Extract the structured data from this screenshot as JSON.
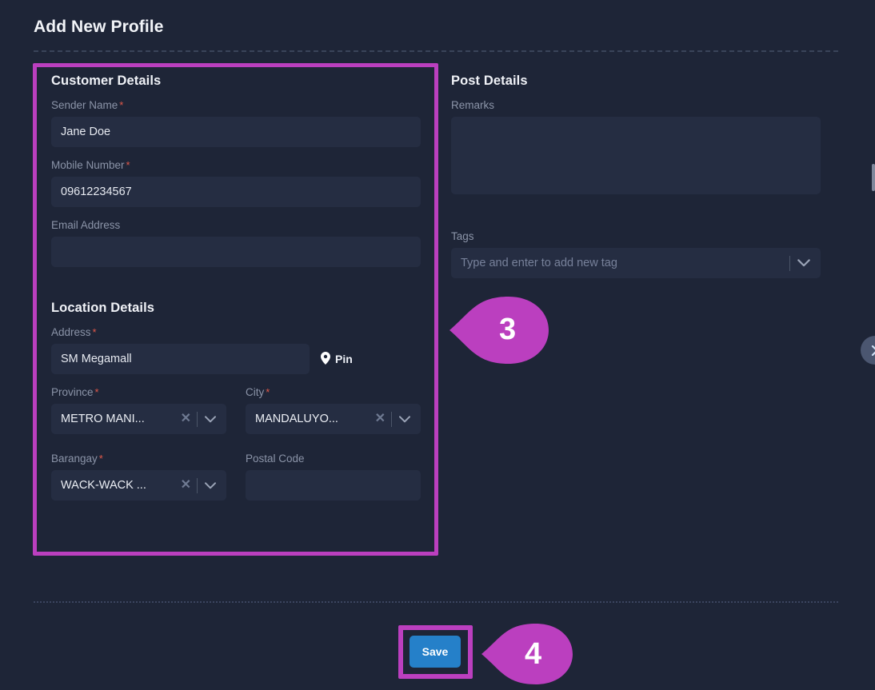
{
  "header": {
    "title": "Add New Profile"
  },
  "customer": {
    "section_title": "Customer Details",
    "sender_name": {
      "label": "Sender Name",
      "required": "*",
      "value": "Jane Doe"
    },
    "mobile_number": {
      "label": "Mobile Number",
      "required": "*",
      "value": "09612234567"
    },
    "email_address": {
      "label": "Email Address",
      "value": ""
    }
  },
  "location": {
    "section_title": "Location Details",
    "address": {
      "label": "Address",
      "required": "*",
      "value": "SM Megamall"
    },
    "pin_button": {
      "label": "Pin",
      "icon": "map-pin-icon"
    },
    "province": {
      "label": "Province",
      "required": "*",
      "value": "METRO MANI...",
      "clear_icon": "close-x-icon",
      "chevron": "chevron-down-icon"
    },
    "city": {
      "label": "City",
      "required": "*",
      "value": "MANDALUYO...",
      "clear_icon": "close-x-icon",
      "chevron": "chevron-down-icon"
    },
    "barangay": {
      "label": "Barangay",
      "required": "*",
      "value": "WACK-WACK ...",
      "clear_icon": "close-x-icon",
      "chevron": "chevron-down-icon"
    },
    "postal_code": {
      "label": "Postal Code",
      "value": ""
    }
  },
  "post": {
    "section_title": "Post Details",
    "remarks": {
      "label": "Remarks",
      "value": ""
    },
    "tags": {
      "label": "Tags",
      "value": "",
      "placeholder": "Type and enter to add new tag",
      "chevron": "chevron-down-icon"
    }
  },
  "footer": {
    "save_label": "Save"
  },
  "callouts": [
    {
      "number": "3"
    },
    {
      "number": "4"
    }
  ],
  "colors": {
    "background": "#1e2537",
    "field": "#252d42",
    "highlight": "#bb3fbf",
    "accent_button": "#2580c9",
    "required_star": "#e2594a",
    "label_text": "#8b94a8"
  }
}
